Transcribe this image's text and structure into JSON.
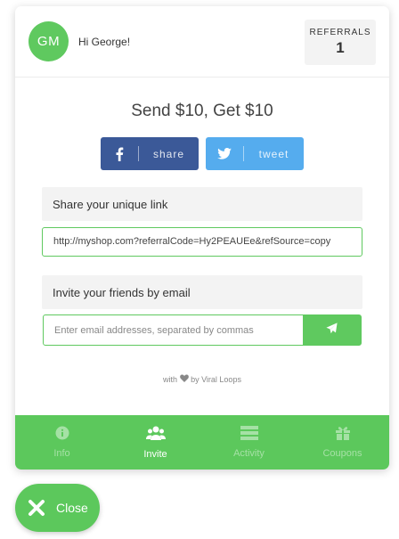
{
  "header": {
    "avatar_initials": "GM",
    "greeting": "Hi George!",
    "referrals_label": "REFERRALS",
    "referrals_count": "1"
  },
  "main": {
    "title": "Send $10, Get $10",
    "facebook_label": "share",
    "twitter_label": "tweet",
    "link_section_label": "Share your unique link",
    "referral_link": "http://myshop.com?referralCode=Hy2PEAUEe&refSource=copy",
    "email_section_label": "Invite your friends by email",
    "email_placeholder": "Enter email addresses, separated by commas",
    "credit_prefix": "with",
    "credit_suffix": "by Viral Loops"
  },
  "tabs": [
    {
      "label": "Info",
      "icon": "info-icon",
      "active": false
    },
    {
      "label": "Invite",
      "icon": "users-icon",
      "active": true
    },
    {
      "label": "Activity",
      "icon": "list-icon",
      "active": false
    },
    {
      "label": "Coupons",
      "icon": "gift-icon",
      "active": false
    }
  ],
  "close_label": "Close",
  "colors": {
    "accent": "#5cc85c",
    "facebook": "#3b5998",
    "twitter": "#55acee"
  }
}
